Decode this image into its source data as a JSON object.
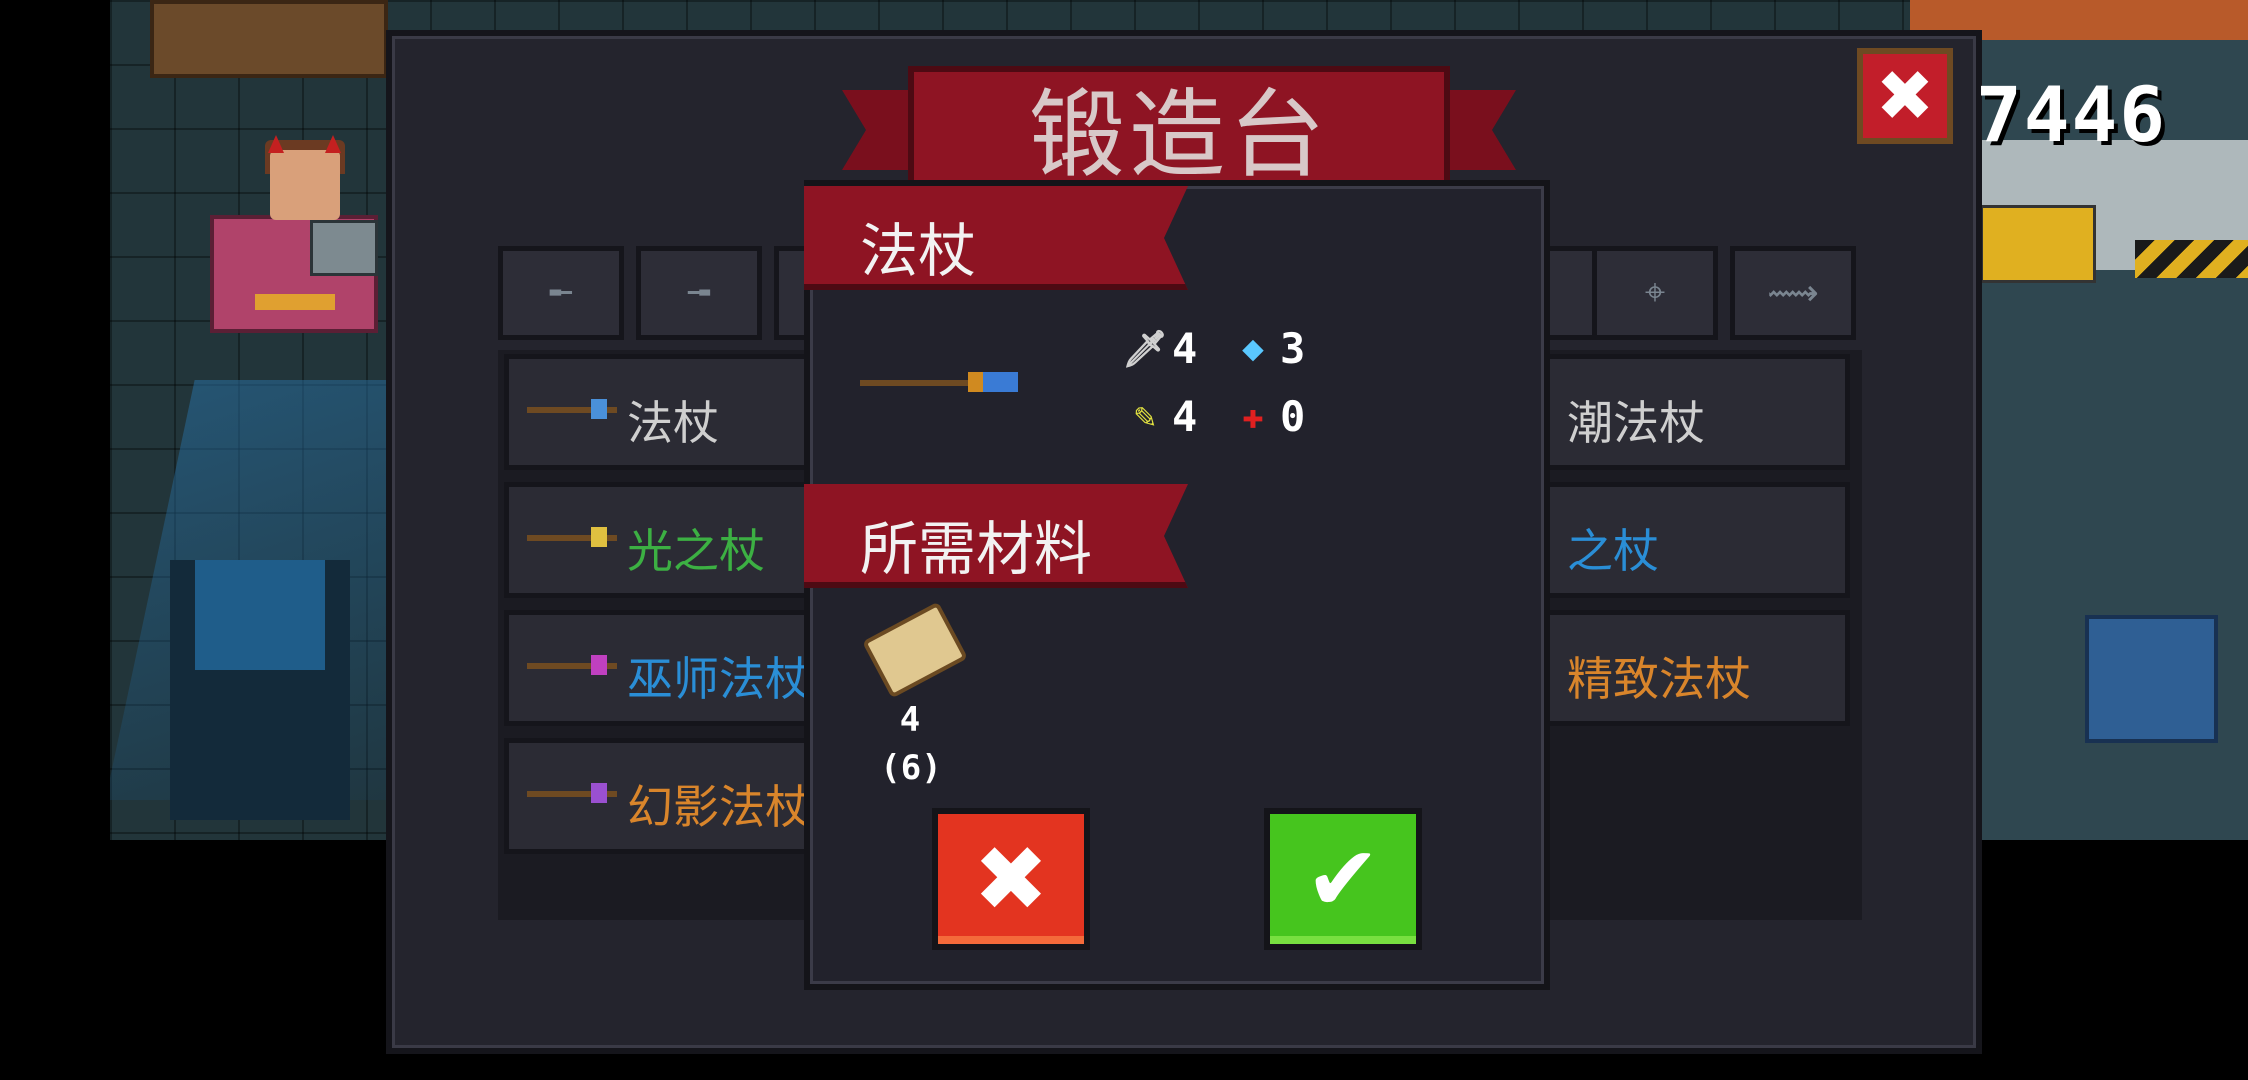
{
  "header": {
    "title": "锻造台",
    "close_icon": "close-icon",
    "coins": "7446"
  },
  "tabs": [
    {
      "icon": "pistol-icon",
      "glyph": "╾"
    },
    {
      "icon": "rifle-icon",
      "glyph": "╼"
    },
    {
      "icon": "weapon-icon",
      "glyph": ""
    },
    {
      "icon": "blaster-icon",
      "glyph": ""
    },
    {
      "icon": "crosshair-icon",
      "glyph": "⌖"
    },
    {
      "icon": "fish-weapon-icon",
      "glyph": "⟿"
    }
  ],
  "weapon_list": [
    {
      "name": "法杖",
      "color": "#cfcfcf",
      "gem": "#4a90d9"
    },
    {
      "name": "潮法杖",
      "color": "#cfcfcf"
    },
    {
      "name": "光之杖",
      "color": "#3cb043",
      "gem": "#e0c040"
    },
    {
      "name": "之杖",
      "color": "#2a8ed6"
    },
    {
      "name": "巫师法杖",
      "color": "#2a8ed6",
      "gem": "#c040c0"
    },
    {
      "name": "精致法杖",
      "color": "#d9852b"
    },
    {
      "name": "幻影法杖",
      "color": "#d9852b",
      "gem": "#9a50d0"
    }
  ],
  "dialog": {
    "item_section_label": "法杖",
    "stats": {
      "attack": "4",
      "energy": "3",
      "crit": "4",
      "spread": "0"
    },
    "materials_section_label": "所需材料",
    "material": {
      "icon": "wood-icon",
      "required": "4",
      "owned": "(6)"
    },
    "cancel_icon": "close-icon",
    "confirm_icon": "check-icon",
    "cancel_glyph": "✖",
    "confirm_glyph": "✔"
  },
  "colors": {
    "banner": "#8e1423",
    "cancel": "#e33420",
    "confirm": "#46c51e"
  }
}
